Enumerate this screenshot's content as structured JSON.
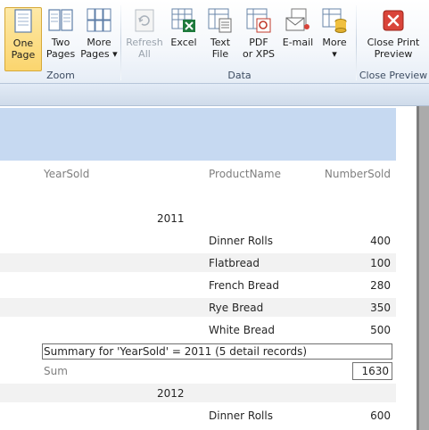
{
  "ribbon": {
    "zoom": {
      "label": "Zoom",
      "one_page": "One\nPage",
      "two_pages": "Two\nPages",
      "more_pages": "More\nPages ▾"
    },
    "data": {
      "label": "Data",
      "refresh_all": "Refresh\nAll",
      "excel": "Excel",
      "text_file": "Text\nFile",
      "pdf_xps": "PDF\nor XPS",
      "email": "E-mail",
      "more": "More\n▾"
    },
    "close_preview": {
      "label": "Close Preview",
      "close_print_preview": "Close Print\nPreview"
    }
  },
  "report": {
    "columns": {
      "year": "YearSold",
      "product": "ProductName",
      "number": "NumberSold"
    },
    "groups": [
      {
        "year": "2011",
        "rows": [
          {
            "product": "Dinner Rolls",
            "number": "400"
          },
          {
            "product": "Flatbread",
            "number": "100"
          },
          {
            "product": "French Bread",
            "number": "280"
          },
          {
            "product": "Rye Bread",
            "number": "350"
          },
          {
            "product": "White Bread",
            "number": "500"
          }
        ],
        "summary": "Summary for 'YearSold' =  2011 (5 detail records)",
        "sum_label": "Sum",
        "sum_value": "1630"
      },
      {
        "year": "2012",
        "rows": [
          {
            "product": "Dinner Rolls",
            "number": "600"
          }
        ]
      }
    ]
  },
  "colors": {
    "header_band": "#c6d9f1",
    "alt_row": "#f2f2f2",
    "active_button": "#fbd56e",
    "close_icon": "#d9443a"
  }
}
